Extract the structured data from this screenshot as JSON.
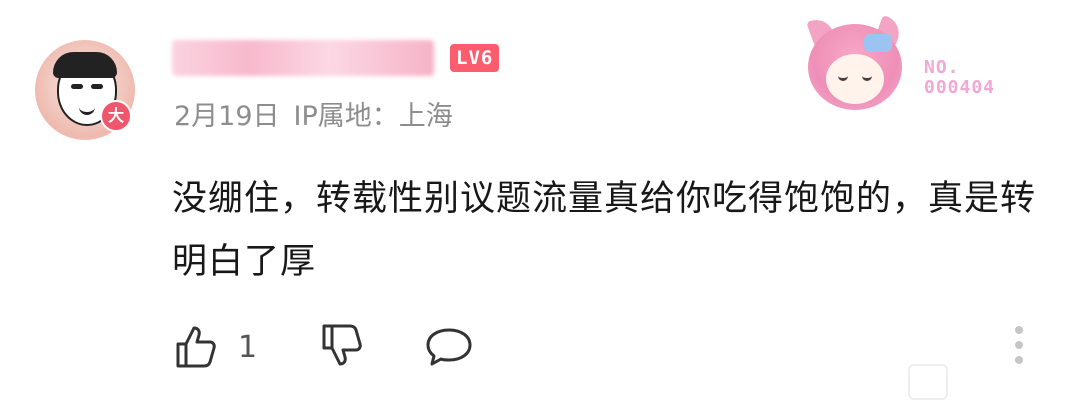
{
  "user": {
    "avatar_badge": "大",
    "level": "LV6",
    "date": "2月19日",
    "ip_location": "IP属地：上海",
    "number_label": "NO.",
    "number_value": "000404"
  },
  "comment": {
    "text": "没绷住，转载性别议题流量真给你吃得饱饱的，真是转明白了厚"
  },
  "actions": {
    "like_count": "1"
  },
  "icons": {
    "like": "thumbs-up-icon",
    "dislike": "thumbs-down-icon",
    "reply": "comment-bubble-icon",
    "more": "more-vertical-icon"
  },
  "colors": {
    "level_bg": "#fb5d6e",
    "meta_text": "#8d8d8d",
    "number": "#f0a8d4"
  }
}
